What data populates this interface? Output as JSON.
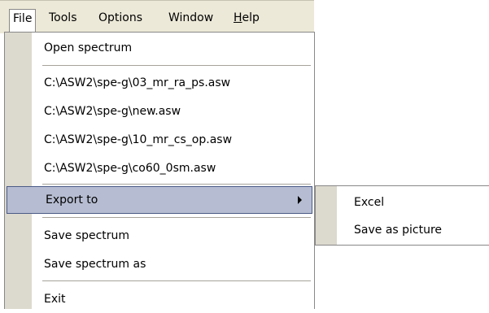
{
  "menubar": {
    "file": "File",
    "tools": "Tools",
    "options": "Options",
    "window": "Window",
    "help_h": "H",
    "help_rest": "elp"
  },
  "file_menu": {
    "open_spectrum": "Open spectrum",
    "recent": [
      "C:\\ASW2\\spe-g\\03_mr_ra_ps.asw",
      "C:\\ASW2\\spe-g\\new.asw",
      "C:\\ASW2\\spe-g\\10_mr_cs_op.asw",
      "C:\\ASW2\\spe-g\\co60_0sm.asw"
    ],
    "export_to": "Export to",
    "save_spectrum": "Save spectrum",
    "save_spectrum_as": "Save spectrum as",
    "exit": "Exit"
  },
  "export_submenu": {
    "excel": "Excel",
    "save_as_picture": "Save as picture"
  }
}
